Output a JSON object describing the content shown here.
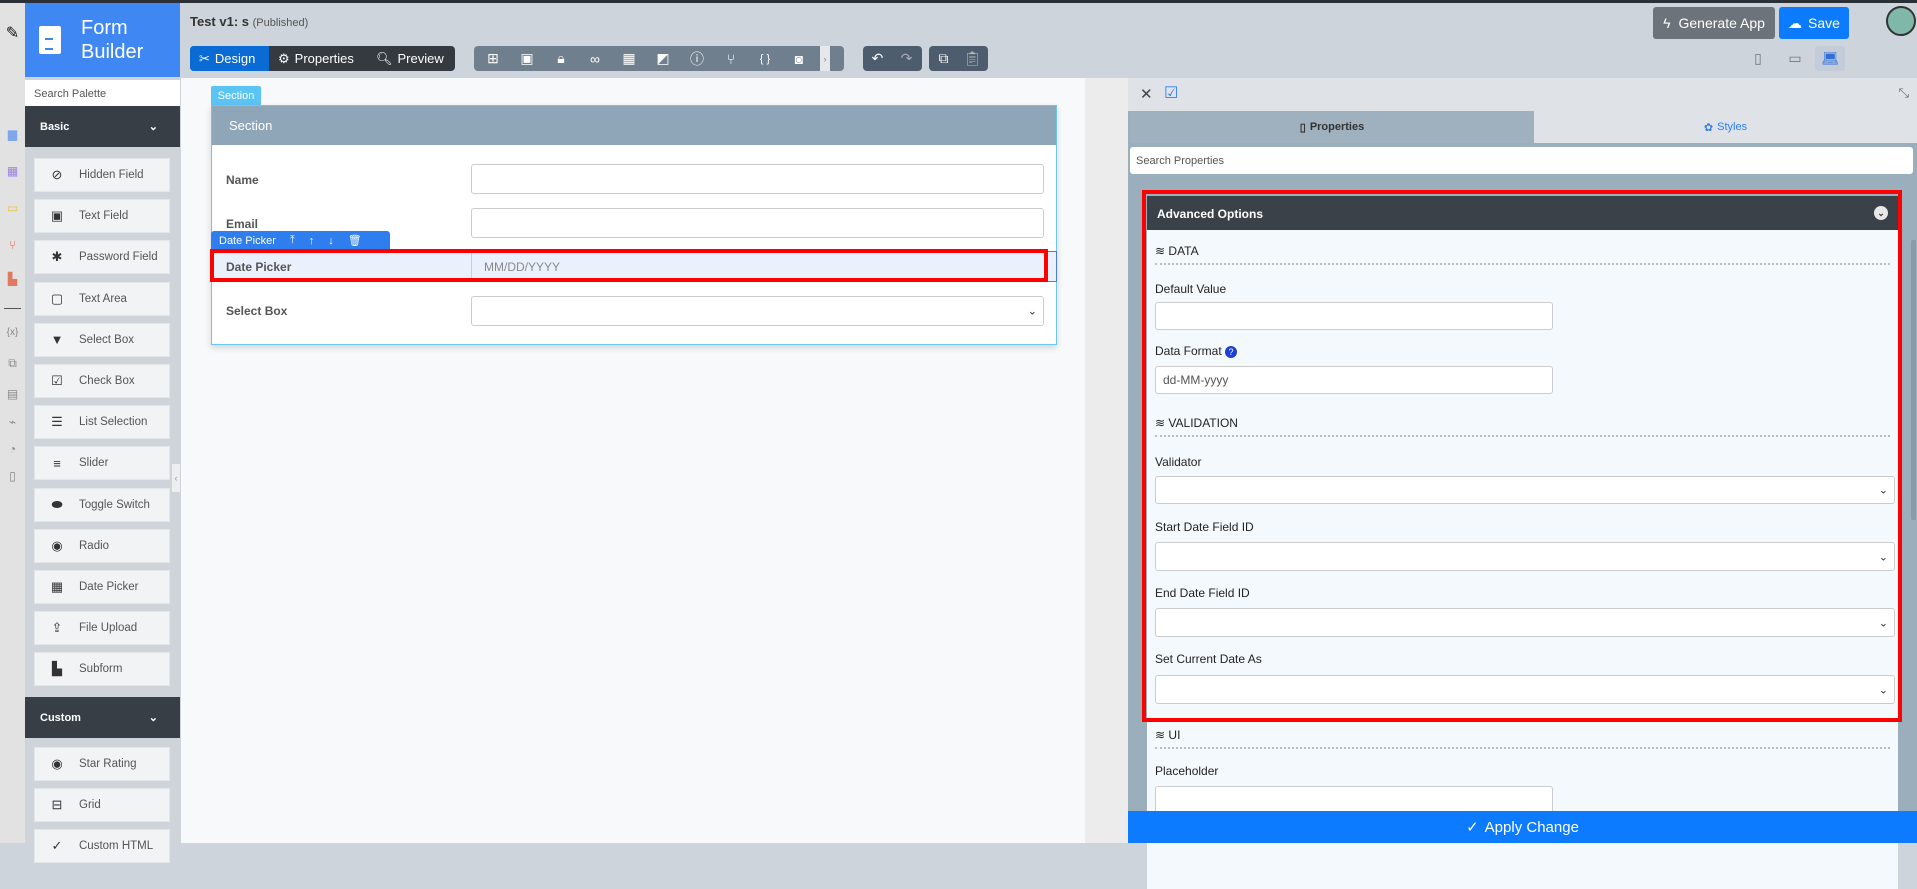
{
  "app": {
    "logo_line1": "Form",
    "logo_line2": "Builder",
    "title": "Test v1: s",
    "status": "(Published)"
  },
  "toolbar": {
    "design": "Design",
    "properties": "Properties",
    "preview": "Preview",
    "icons": [
      "sitemap-icon",
      "form-icon",
      "lock-icon",
      "binoculars-icon",
      "table-icon",
      "translate-icon",
      "help-icon",
      "branch-icon",
      "braces-icon",
      "camera-icon"
    ],
    "generate_app": "Generate App",
    "save": "Save"
  },
  "rail_icons": [
    "edit-icon",
    "form-icon",
    "table-icon",
    "monitor-icon",
    "flow-icon",
    "pdf-icon",
    "variable-icon",
    "translate-icon",
    "file-icon",
    "plug-icon",
    "gauge-icon",
    "scroll-icon"
  ],
  "palette": {
    "search_placeholder": "Search Palette",
    "basic_header": "Basic",
    "basic_items": [
      "Hidden Field",
      "Text Field",
      "Password Field",
      "Text Area",
      "Select Box",
      "Check Box",
      "List Selection",
      "Slider",
      "Toggle Switch",
      "Radio",
      "Date Picker",
      "File Upload",
      "Subform"
    ],
    "custom_header": "Custom",
    "custom_items": [
      "Star Rating",
      "Grid",
      "Custom HTML"
    ]
  },
  "form": {
    "section_tab": "Section",
    "section_title": "Section",
    "fields": {
      "name": "Name",
      "email": "Email",
      "date_picker": "Date Picker",
      "date_placeholder": "MM/DD/YYYY",
      "select_box": "Select Box"
    },
    "toolbar_label": "Date Picker"
  },
  "props": {
    "tab_properties": "Properties",
    "tab_styles": "Styles",
    "search_placeholder": "Search Properties",
    "card_title": "Advanced Options",
    "data_section": "DATA",
    "default_value": "Default Value",
    "data_format": "Data Format",
    "data_format_value": "dd-MM-yyyy",
    "validation_section": "VALIDATION",
    "validator": "Validator",
    "start_date": "Start Date Field ID",
    "end_date": "End Date Field ID",
    "set_current": "Set Current Date As",
    "ui_section": "UI",
    "placeholder": "Placeholder",
    "apply": "Apply Change"
  }
}
